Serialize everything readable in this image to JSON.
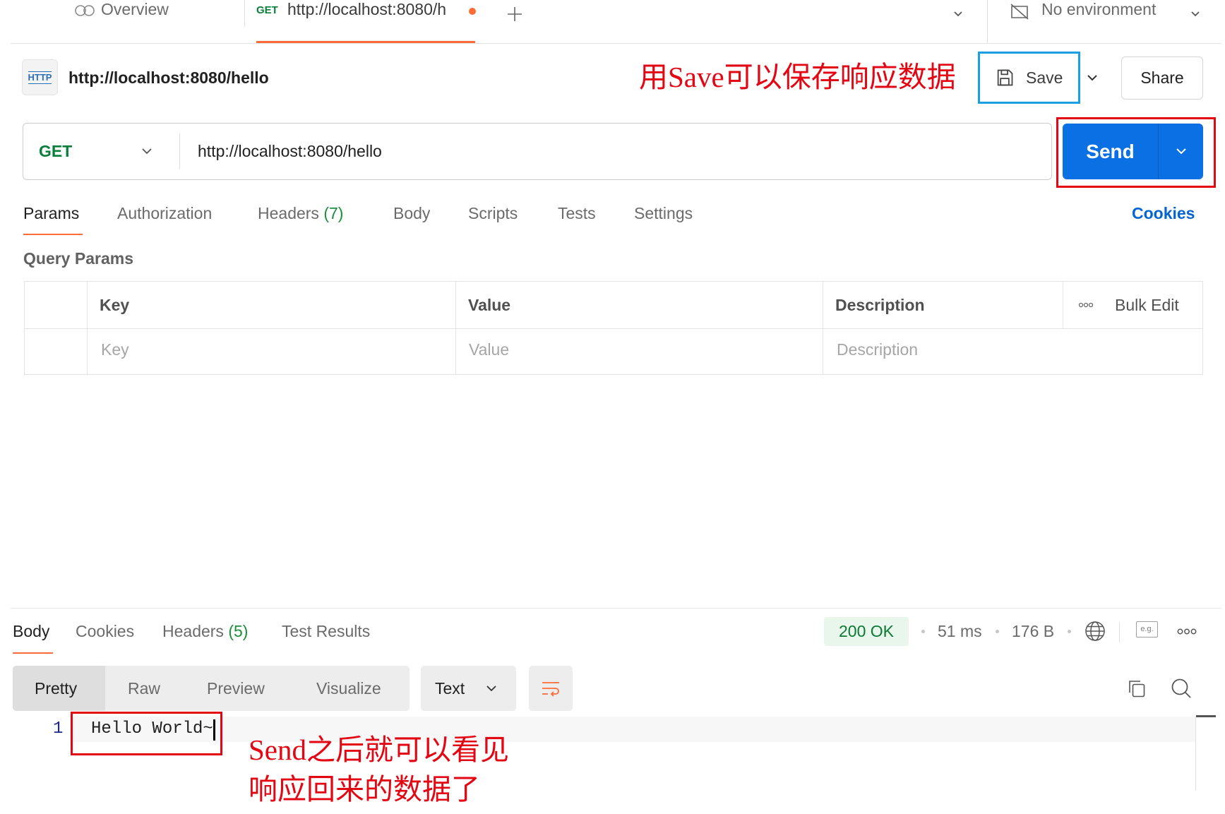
{
  "tabs_bar": {
    "overview_label": "Overview",
    "request_tab": {
      "method": "GET",
      "title": "http://localhost:8080/h",
      "unsaved": true
    },
    "environment": "No environment"
  },
  "request": {
    "http_icon_label": "HTTP",
    "title": "http://localhost:8080/hello",
    "save_label": "Save",
    "share_label": "Share",
    "method": "GET",
    "url": "http://localhost:8080/hello",
    "send_label": "Send"
  },
  "annotations": {
    "save_note": "用Save可以保存响应数据",
    "send_note_line1": "Send之后就可以看见",
    "send_note_line2": "响应回来的数据了"
  },
  "request_tabs": [
    {
      "label": "Params",
      "active": true
    },
    {
      "label": "Authorization"
    },
    {
      "label": "Headers",
      "count": "(7)"
    },
    {
      "label": "Body"
    },
    {
      "label": "Scripts"
    },
    {
      "label": "Tests"
    },
    {
      "label": "Settings"
    }
  ],
  "cookies_link": "Cookies",
  "query_params": {
    "title": "Query Params",
    "headers": {
      "key": "Key",
      "value": "Value",
      "description": "Description",
      "bulk_edit": "Bulk Edit"
    },
    "placeholders": {
      "key": "Key",
      "value": "Value",
      "description": "Description"
    }
  },
  "response": {
    "tabs": [
      {
        "label": "Body",
        "active": true
      },
      {
        "label": "Cookies"
      },
      {
        "label": "Headers",
        "count": "(5)"
      },
      {
        "label": "Test Results"
      }
    ],
    "status": "200 OK",
    "time": "51 ms",
    "size": "176 B",
    "example_label": "e.g.",
    "view_modes": [
      "Pretty",
      "Raw",
      "Preview",
      "Visualize"
    ],
    "active_view_mode_index": 0,
    "format": "Text",
    "lines": [
      {
        "number": "1",
        "text": "Hello World~"
      }
    ]
  },
  "colors": {
    "accent": "#FF6C37",
    "send_button": "#0A70E3",
    "method_get": "#0A7F3B",
    "status_ok": "#0A7A33",
    "link": "#0265D2",
    "annotation_red": "#E30613",
    "annotation_blue": "#1AA0E0"
  },
  "icons": [
    "overview-icon",
    "add-tab-icon",
    "no-environment-icon",
    "chevron-down-icon",
    "http-icon",
    "save-icon",
    "more-icon",
    "globe-icon",
    "example-icon",
    "wrap-lines-icon",
    "copy-icon",
    "search-icon"
  ]
}
